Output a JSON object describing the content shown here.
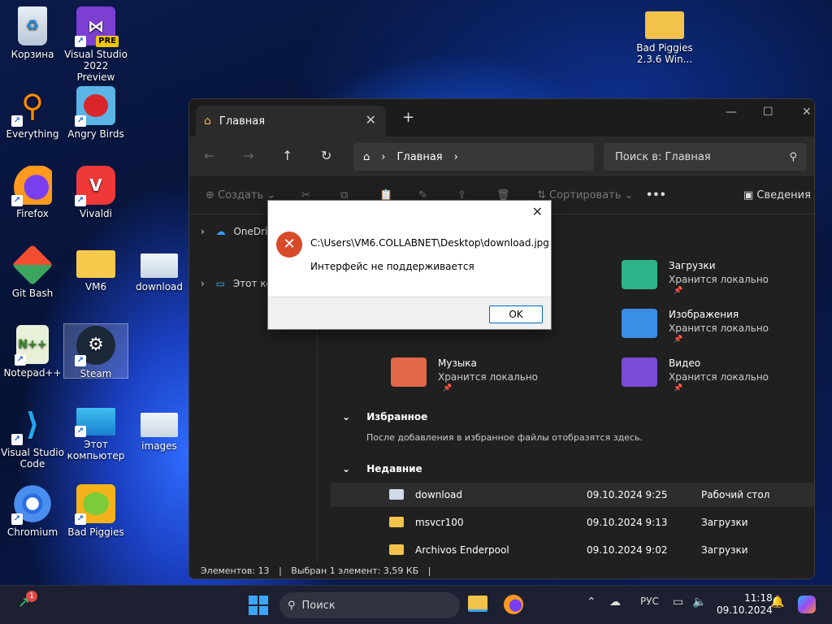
{
  "desktop": {
    "icons": [
      {
        "label": "Корзина",
        "icon": "recycle-bin-icon"
      },
      {
        "label": "Visual Studio 2022 Preview",
        "badge": "PRE",
        "icon": "visual-studio-preview-icon"
      },
      {
        "label": "Bad Piggies 2.3.6 Win...",
        "icon": "folder-icon"
      },
      {
        "label": "Everything",
        "icon": "everything-search-icon"
      },
      {
        "label": "Angry Birds",
        "icon": "angry-birds-icon"
      },
      {
        "label": "Firefox",
        "icon": "firefox-icon"
      },
      {
        "label": "Vivaldi",
        "icon": "vivaldi-icon"
      },
      {
        "label": "Git Bash",
        "icon": "git-bash-icon"
      },
      {
        "label": "VM6",
        "icon": "folder-icon"
      },
      {
        "label": "download",
        "icon": "image-file-icon"
      },
      {
        "label": "Notepad++",
        "icon": "notepad-plus-plus-icon"
      },
      {
        "label": "Steam",
        "icon": "steam-icon"
      },
      {
        "label": "Visual Studio Code",
        "icon": "vscode-icon"
      },
      {
        "label": "Этот компьютер",
        "icon": "this-pc-icon"
      },
      {
        "label": "images",
        "icon": "image-file-icon"
      },
      {
        "label": "Chromium",
        "icon": "chromium-icon"
      },
      {
        "label": "Bad Piggies",
        "icon": "bad-piggies-icon"
      }
    ]
  },
  "explorer": {
    "tab_title": "Главная",
    "address": "Главная",
    "search_placeholder": "Поиск в: Главная",
    "toolbar": {
      "create": "Создать",
      "sort": "Сортировать",
      "details": "Сведения"
    },
    "nav_pane": [
      {
        "label": "OneDrive"
      },
      {
        "label": "Этот компьютер"
      }
    ],
    "quick_access": [
      {
        "name": "Загрузки",
        "status": "Хранится локально",
        "color": "#2db38a"
      },
      {
        "name": "Изображения",
        "status": "Хранится локально",
        "color": "#3a8ee6"
      },
      {
        "name": "Музыка",
        "status": "Хранится локально",
        "color": "#e2684a"
      },
      {
        "name": "Видео",
        "status": "Хранится локально",
        "color": "#7a4bd6"
      }
    ],
    "favorites": {
      "title": "Избранное",
      "hint": "После добавления в избранное файлы отобразятся здесь."
    },
    "recent": {
      "title": "Недавние",
      "rows": [
        {
          "name": "download",
          "date": "09.10.2024 9:25",
          "location": "Рабочий стол"
        },
        {
          "name": "msvcr100",
          "date": "09.10.2024 9:13",
          "location": "Загрузки"
        },
        {
          "name": "Archivos Enderpool",
          "date": "09.10.2024 9:02",
          "location": "Загрузки"
        }
      ]
    },
    "status": {
      "items": "Элементов: 13",
      "selected": "Выбран 1 элемент: 3,59 КБ"
    }
  },
  "dialog": {
    "path": "C:\\Users\\VM6.COLLABNET\\Desktop\\download.jpg",
    "message": "Интерфейс не поддерживается",
    "ok_label": "OK"
  },
  "taskbar": {
    "search_placeholder": "Поиск",
    "notification_count": "1",
    "language": "РУС",
    "time": "11:18",
    "date": "09.10.2024"
  },
  "colors": {
    "accent": "#0067c0",
    "error": "#d74a2a"
  }
}
